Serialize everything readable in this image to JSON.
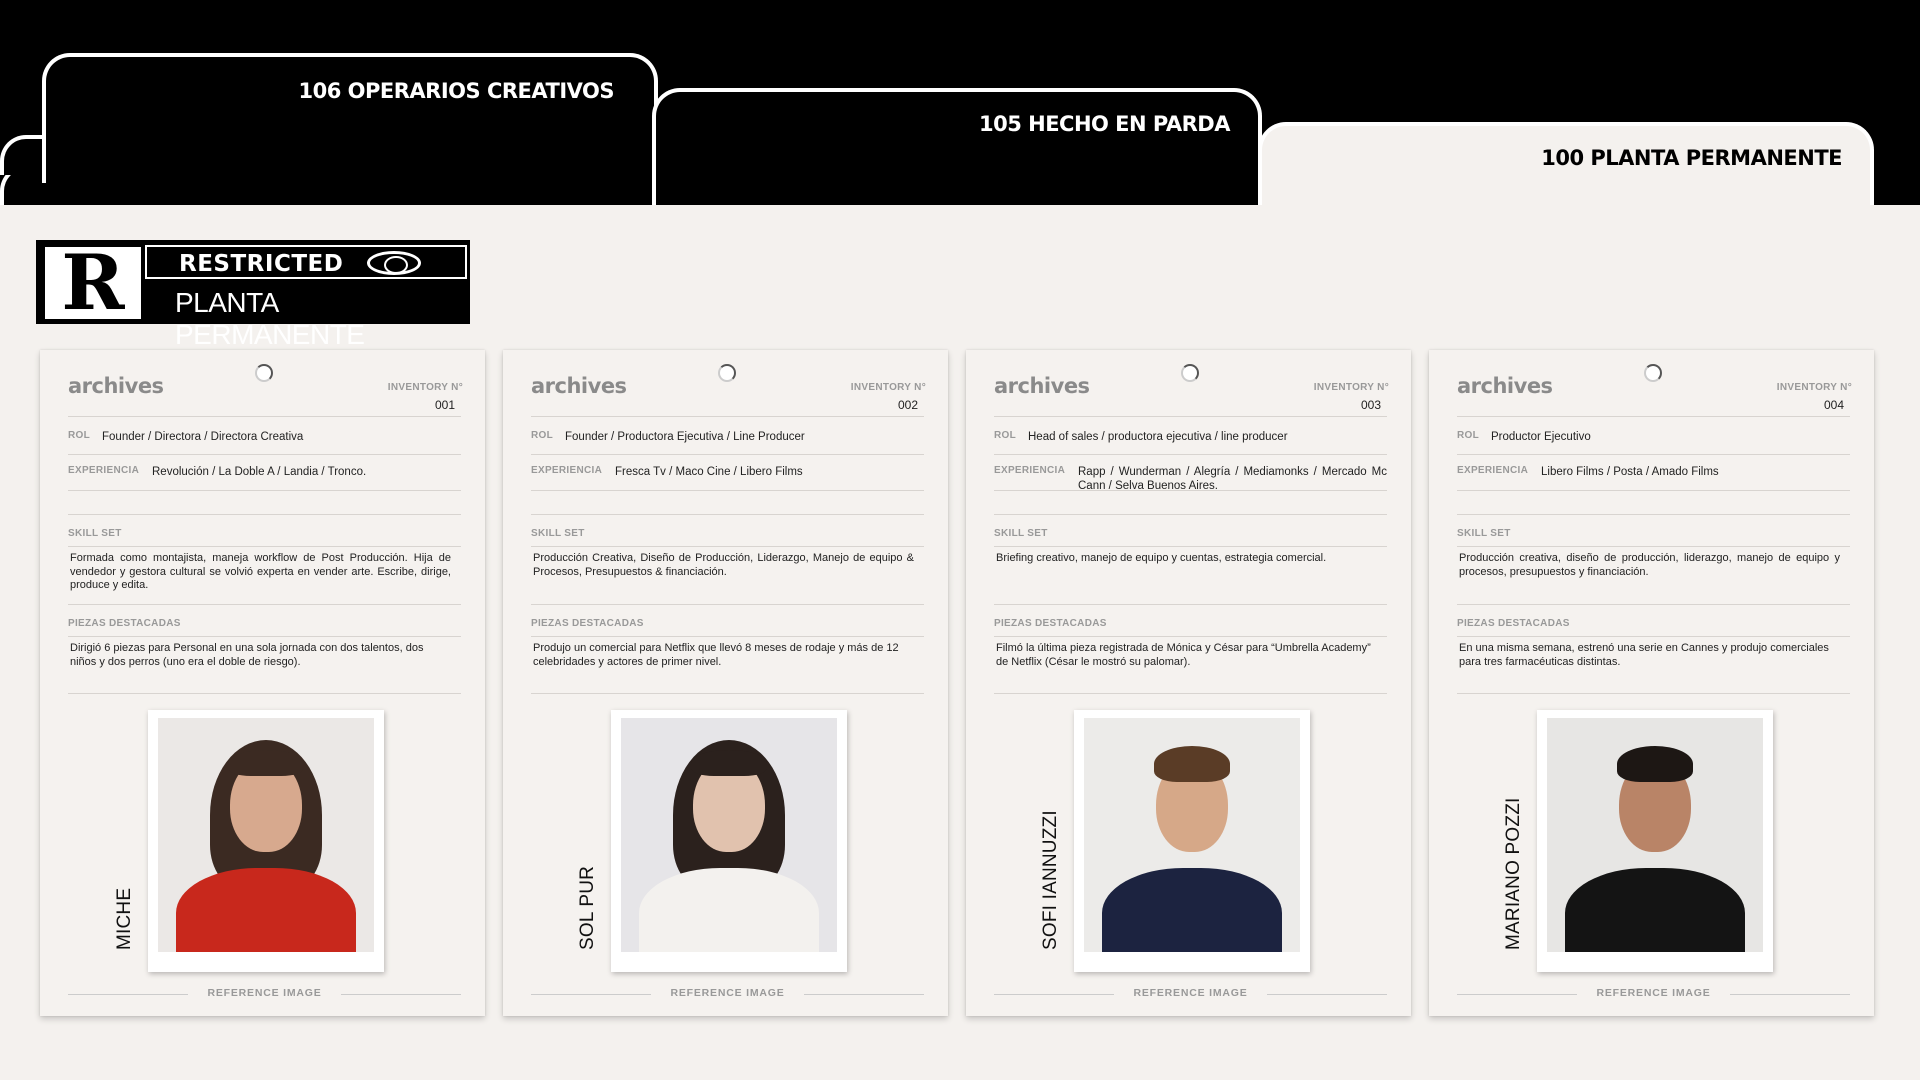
{
  "tabs": [
    {
      "label": "106 OPERARIOS CREATIVOS",
      "active": false
    },
    {
      "label": "105 HECHO EN PARDA",
      "active": false
    },
    {
      "label": "100 PLANTA PERMANENTE",
      "active": true
    }
  ],
  "badge": {
    "letter": "R",
    "top_label": "RESTRICTED",
    "bottom_label": "PLANTA PERMANENTE"
  },
  "cards": [
    {
      "brand": "archives",
      "inventory_label": "INVENTORY N°",
      "inventory_number": "001",
      "rol_label": "ROL",
      "rol": "Founder / Directora / Directora Creativa",
      "experiencia_label": "EXPERIENCIA",
      "experiencia": "Revolución  / La Doble A / Landia / Tronco.",
      "skill_label": "SKILL SET",
      "skill": "Formada como montajista, maneja workflow de Post Producción. Hija de vendedor y gestora cultural se volvió experta en vender arte. Escribe, dirige, produce y edita.",
      "piezas_label": "PIEZAS DESTACADAS",
      "piezas": "Dirigió 6 piezas para Personal en una sola jornada con dos talentos, dos niños y dos perros (uno era el doble de riesgo).",
      "name": "MICHE",
      "reference_label": "REFERENCE IMAGE"
    },
    {
      "brand": "archives",
      "inventory_label": "INVENTORY N°",
      "inventory_number": "002",
      "rol_label": "ROL",
      "rol": "Founder / Productora Ejecutiva / Line Producer",
      "experiencia_label": "EXPERIENCIA",
      "experiencia": "Fresca Tv / Maco Cine / Libero Films",
      "skill_label": "SKILL SET",
      "skill": "Producción Creativa, Diseño de Producción, Liderazgo, Manejo de equipo & Procesos, Presupuestos & financiación.",
      "piezas_label": "PIEZAS DESTACADAS",
      "piezas": "Produjo un comercial para Netflix que llevó 8 meses de rodaje y más de 12 celebridades y actores de primer nivel.",
      "name": "SOL PUR",
      "reference_label": "REFERENCE IMAGE"
    },
    {
      "brand": "archives",
      "inventory_label": "INVENTORY N°",
      "inventory_number": "003",
      "rol_label": "ROL",
      "rol": "Head of sales / productora ejecutiva / line producer",
      "experiencia_label": "EXPERIENCIA",
      "experiencia": "Rapp / Wunderman / Alegría / Mediamonks / Mercado Mc Cann / Selva Buenos Aires.",
      "skill_label": "SKILL SET",
      "skill": "Briefing creativo, manejo de equipo y cuentas, estrategia comercial.",
      "piezas_label": "PIEZAS DESTACADAS",
      "piezas": "Filmó la última pieza registrada de Mónica y César para “Umbrella Academy” de Netflix (César le mostró su palomar).",
      "name": "SOFI IANNUZZI",
      "reference_label": "REFERENCE IMAGE"
    },
    {
      "brand": "archives",
      "inventory_label": "INVENTORY N°",
      "inventory_number": "004",
      "rol_label": "ROL",
      "rol": "Productor Ejecutivo",
      "experiencia_label": "EXPERIENCIA",
      "experiencia": "Libero Films / Posta / Amado Films",
      "skill_label": "SKILL SET",
      "skill": "Producción creativa, diseño de producción, liderazgo, manejo de equipo y procesos, presupuestos y financiación.",
      "piezas_label": "PIEZAS DESTACADAS",
      "piezas": "En una misma semana, estrenó una serie en Cannes y produjo comerciales para tres farmacéuticas distintas.",
      "name": "MARIANO POZZI",
      "reference_label": "REFERENCE IMAGE"
    }
  ],
  "colors": {
    "background": "#000000",
    "panel": "#f4f1ee",
    "label_gray": "#999999"
  }
}
